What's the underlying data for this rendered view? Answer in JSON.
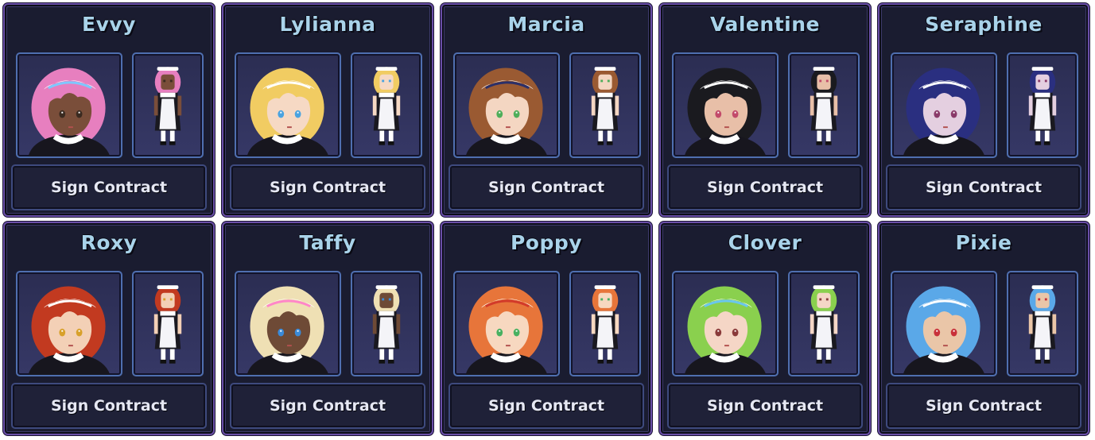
{
  "button_label": "Sign Contract",
  "colors": {
    "card_bg": "#1a1c30",
    "card_border": "#6a4fa8",
    "name_text": "#a9d3ea",
    "button_text": "#e6e8f4",
    "frame_border": "#4f6fb0"
  },
  "characters": [
    {
      "name": "Evvy",
      "hair": "#e77fbf",
      "skin": "#7a4e3a",
      "eye": "#3a2a20",
      "accent": "#7ec8ff"
    },
    {
      "name": "Lylianna",
      "hair": "#f1cc62",
      "skin": "#f6d9c4",
      "eye": "#4aa3e0",
      "accent": "#ffffff"
    },
    {
      "name": "Marcia",
      "hair": "#9a5a32",
      "skin": "#f4d6c2",
      "eye": "#4fae5a",
      "accent": "#2a2f6a"
    },
    {
      "name": "Valentine",
      "hair": "#1a1a1f",
      "skin": "#e8bfa8",
      "eye": "#c24a6a",
      "accent": "#ffffff"
    },
    {
      "name": "Seraphine",
      "hair": "#2a2f80",
      "skin": "#e4cfe0",
      "eye": "#8a3a6a",
      "accent": "#ffffff"
    },
    {
      "name": "Roxy",
      "hair": "#c23a20",
      "skin": "#f3d0b6",
      "eye": "#d8a02a",
      "accent": "#ffffff"
    },
    {
      "name": "Taffy",
      "hair": "#efe0b4",
      "skin": "#6e4a36",
      "eye": "#3a8ad8",
      "accent": "#ff86c8"
    },
    {
      "name": "Poppy",
      "hair": "#e7753a",
      "skin": "#f7d8c0",
      "eye": "#48b060",
      "accent": "#d23a2a"
    },
    {
      "name": "Clover",
      "hair": "#8ad04e",
      "skin": "#f5d6c6",
      "eye": "#8a3a3a",
      "accent": "#6ac6ef"
    },
    {
      "name": "Pixie",
      "hair": "#5aa8e8",
      "skin": "#eac6a8",
      "eye": "#c8303a",
      "accent": "#ffffff"
    }
  ]
}
